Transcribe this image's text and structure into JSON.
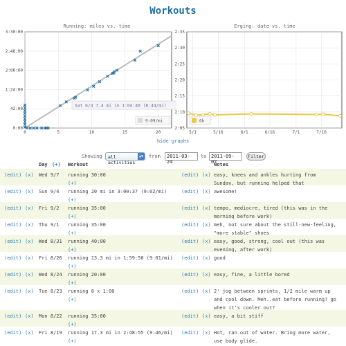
{
  "page": {
    "title": "Workouts"
  },
  "charts": {
    "running": {
      "title": "Running: miles vs. time"
    },
    "erging": {
      "title": "Erging: date vs. time"
    },
    "hide_graphs": "hide graphs"
  },
  "chart_data": [
    {
      "type": "scatter",
      "title": "Running: miles vs. time",
      "xlabel": "",
      "ylabel": "",
      "x_ticks": [
        "0",
        "5",
        "10",
        "15",
        "20"
      ],
      "y_ticks": [
        "0:00",
        "42:00",
        "1:24:00",
        "2:06:00",
        "2:48:00",
        "3:30:00"
      ],
      "xlim": [
        0,
        22
      ],
      "ylim_minutes": [
        0,
        210
      ],
      "grid": true,
      "legend": {
        "placement": "bottom-right",
        "entries": [
          "9:09/mi"
        ]
      },
      "tooltip": "Sat 6/4 7.4 mi in 1:04:40 (8:44/mi)",
      "trend_line": {
        "pace_min_per_mi": 9.15
      },
      "points": [
        {
          "miles": 0,
          "minutes": 2
        },
        {
          "miles": 0,
          "minutes": 8
        },
        {
          "miles": 0,
          "minutes": 14
        },
        {
          "miles": 0,
          "minutes": 20
        },
        {
          "miles": 0,
          "minutes": 26
        },
        {
          "miles": 0,
          "minutes": 32
        },
        {
          "miles": 0,
          "minutes": 38
        },
        {
          "miles": 0,
          "minutes": 44
        },
        {
          "miles": 0,
          "minutes": 50
        },
        {
          "miles": 0.3,
          "minutes": 0
        },
        {
          "miles": 0.8,
          "minutes": 0
        },
        {
          "miles": 1.3,
          "minutes": 0
        },
        {
          "miles": 1.8,
          "minutes": 0
        },
        {
          "miles": 2.5,
          "minutes": 0
        },
        {
          "miles": 3.0,
          "minutes": 0
        },
        {
          "miles": 3.2,
          "minutes": 0
        },
        {
          "miles": 3.5,
          "minutes": 0
        },
        {
          "miles": 5.3,
          "minutes": 49
        },
        {
          "miles": 6.2,
          "minutes": 57
        },
        {
          "miles": 7.4,
          "minutes": 65
        },
        {
          "miles": 7.6,
          "minutes": 67
        },
        {
          "miles": 9.4,
          "minutes": 83
        },
        {
          "miles": 10.3,
          "minutes": 91
        },
        {
          "miles": 11.2,
          "minutes": 101
        },
        {
          "miles": 12.4,
          "minutes": 113
        },
        {
          "miles": 13.1,
          "minutes": 119
        },
        {
          "miles": 13.3,
          "minutes": 120
        },
        {
          "miles": 13.4,
          "minutes": 123
        },
        {
          "miles": 13.8,
          "minutes": 126
        },
        {
          "miles": 16.5,
          "minutes": 148
        },
        {
          "miles": 17.3,
          "minutes": 168
        },
        {
          "miles": 20.0,
          "minutes": 180
        }
      ]
    },
    {
      "type": "line",
      "title": "Erging: date vs. time",
      "xlabel": "",
      "ylabel": "",
      "x_ticks": [
        "5/1",
        "5/16",
        "6/1",
        "6/16",
        "7/1",
        "7/16"
      ],
      "y_ticks": [
        "2:05",
        "2:10",
        "2:15",
        "2:20",
        "2:25",
        "2:30",
        "2:35"
      ],
      "ylim_seconds": [
        125,
        155
      ],
      "grid": true,
      "legend": {
        "placement": "bottom-left",
        "entries": [
          "6k"
        ]
      },
      "series": [
        {
          "name": "6k",
          "color": "#e9c94a",
          "points": [
            {
              "date": "4/29",
              "seconds": 129.6
            },
            {
              "date": "5/3",
              "seconds": 129.0
            },
            {
              "date": "5/7",
              "seconds": 129.2
            },
            {
              "date": "5/11",
              "seconds": 129.4
            },
            {
              "date": "5/14",
              "seconds": 129.1
            },
            {
              "date": "6/5",
              "seconds": 129.4
            },
            {
              "date": "7/13",
              "seconds": 129.2
            },
            {
              "date": "7/17",
              "seconds": 129.3
            },
            {
              "date": "7/27",
              "seconds": 128.8
            }
          ]
        }
      ]
    }
  ],
  "filter": {
    "label": "Showing",
    "select_value": "all activities",
    "from_label": "from",
    "from_value": "2011-03-24",
    "to_label": "to",
    "to_value": "2011-09-07",
    "button": "Filter"
  },
  "table": {
    "headers": {
      "day": "Day",
      "day_plus": "(+)",
      "workout": "Workout",
      "notes": "Notes"
    },
    "edit_label": "(edit)",
    "delete_label": "(x)",
    "plus_label": "(+)",
    "rows": [
      {
        "day": "Wed 9/7",
        "workout": "running 30:00",
        "notes1": "easy, knees and ankles hurting from",
        "notes2": "Sunday, but running helped that"
      },
      {
        "day": "Sun 9/4",
        "workout": "running 20 mi in 3:00:37 (9:02/mi)",
        "notes1": "awesome!",
        "notes2": ""
      },
      {
        "day": "Fri 9/2",
        "workout": "running 35:00",
        "notes1": "tempo, mediocre, tired (this was in the",
        "notes2": "morning before work)"
      },
      {
        "day": "Thu 9/1",
        "workout": "running 35:00",
        "notes1": "meh, not sure about the still-new-feeling,",
        "notes2": "\"more stable\" shoes"
      },
      {
        "day": "Wed 8/31",
        "workout": "running 40:00",
        "notes1": "easy, good, strong, cool out (this was",
        "notes2": "evening, after work)"
      },
      {
        "day": "Fri 8/26",
        "workout": "running 13.3 mi in 1:59:50 (9:01/mi)",
        "notes1": "good",
        "notes2": ""
      },
      {
        "day": "Wed 8/24",
        "workout": "running 20:00",
        "notes1": "easy, fine, a little bored",
        "notes2": ""
      },
      {
        "day": "Tue 8/23",
        "workout": "running 8 x 1:00",
        "notes1": "2' jog between sprints, 1/2 mile warm up",
        "notes2": "and cool down. Meh..eat before running? go",
        "notes3": "when it's cooler out?"
      },
      {
        "day": "Mon 8/22",
        "workout": "running 35:00",
        "notes1": "easy, a bit stiff",
        "notes2": ""
      },
      {
        "day": "Fri 8/19",
        "workout": "running 17.3 mi in 2:48:55 (9:46/mi)",
        "notes1": "Hot, ran out of water. Bring more water,",
        "notes2": "use body glide."
      }
    ]
  },
  "colors": {
    "accent": "#1f6fa0",
    "link": "#2a7ab8",
    "row_stripe": "#f3f7e3",
    "marker": "#1f6fa0",
    "erg_line": "#e9c94a"
  },
  "icons": {
    "select_arrow": "chevron-updown-icon"
  }
}
